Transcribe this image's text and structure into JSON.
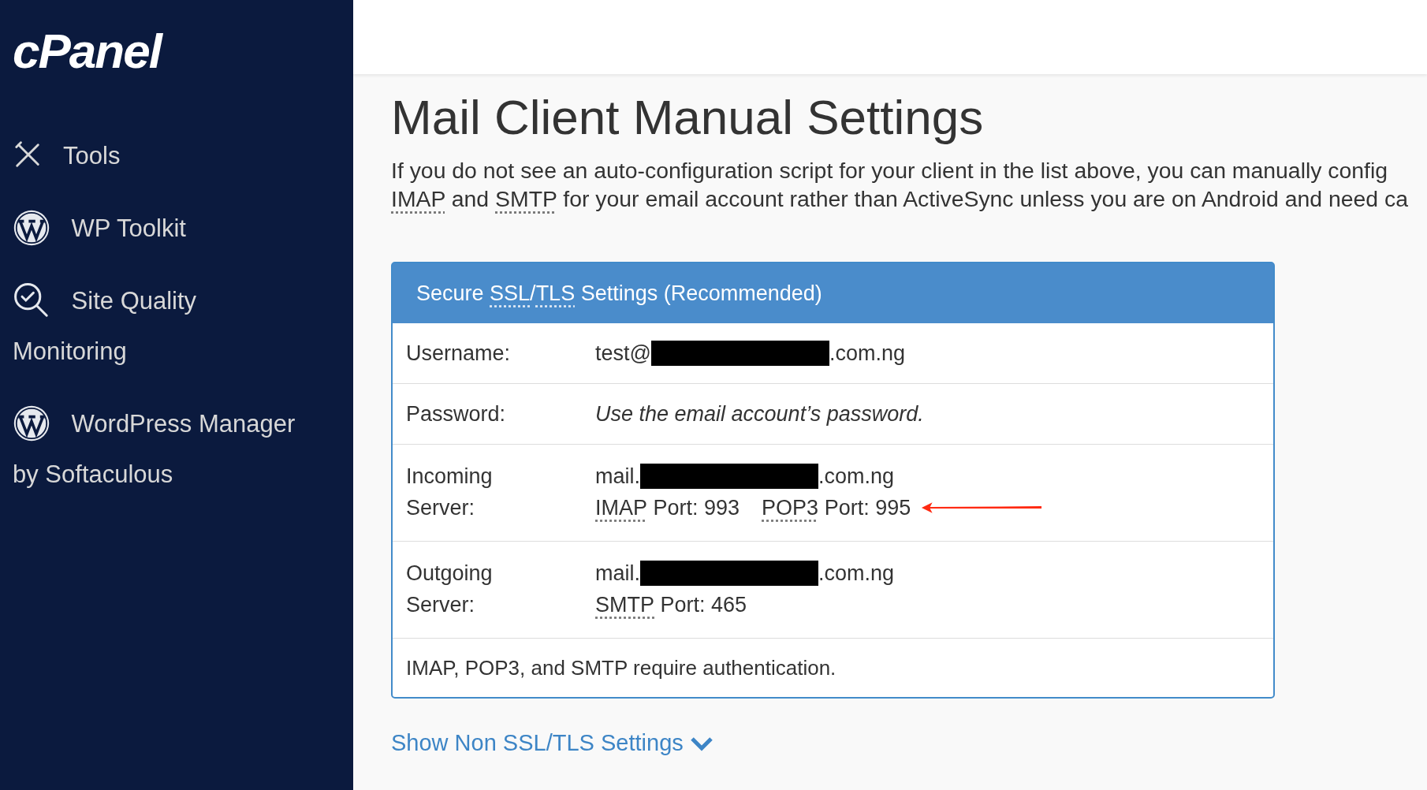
{
  "sidebar": {
    "logo": "cPanel",
    "items": [
      {
        "kind": "tools",
        "label": "Tools"
      },
      {
        "kind": "wordpress",
        "label": "WP Toolkit"
      },
      {
        "kind": "search",
        "label": "Site Quality Monitoring"
      },
      {
        "kind": "wordpress",
        "label": "WordPress Manager by Softaculous"
      }
    ]
  },
  "page": {
    "title": "Mail Client Manual Settings",
    "intro_lines": [
      [
        {
          "kind": "text",
          "text": "If you do not see an auto-configuration script for your client in the list above, you can manually config"
        }
      ],
      [
        {
          "kind": "abbr",
          "text": "IMAP"
        },
        {
          "kind": "text",
          "text": " and "
        },
        {
          "kind": "abbr",
          "text": "SMTP"
        },
        {
          "kind": "text",
          "text": " for your email account rather than ActiveSync unless you are on Android and need ca"
        }
      ]
    ]
  },
  "settings_panel": {
    "title": [
      {
        "kind": "text",
        "text": "Secure "
      },
      {
        "kind": "abbr",
        "text": "SSL"
      },
      {
        "kind": "text",
        "text": "/"
      },
      {
        "kind": "abbr",
        "text": "TLS"
      },
      {
        "kind": "text",
        "text": " Settings (Recommended)"
      }
    ],
    "rows": [
      {
        "label": "Username:",
        "lines": [
          [
            {
              "kind": "text",
              "text": "test@"
            },
            {
              "kind": "redacted"
            },
            {
              "kind": "text",
              "text": ".com.ng"
            }
          ]
        ]
      },
      {
        "label": "Password:",
        "lines": [
          [
            {
              "kind": "italic",
              "text": "Use the email account’s password."
            }
          ]
        ]
      },
      {
        "label": "Incoming Server:",
        "lines": [
          [
            {
              "kind": "text",
              "text": "mail."
            },
            {
              "kind": "redacted"
            },
            {
              "kind": "text",
              "text": ".com.ng"
            }
          ],
          [
            {
              "kind": "abbr",
              "text": "IMAP"
            },
            {
              "kind": "text",
              "text": " Port: 993"
            },
            {
              "kind": "gap"
            },
            {
              "kind": "abbr",
              "text": "POP3"
            },
            {
              "kind": "text",
              "text": " Port: 995"
            },
            {
              "kind": "arrow"
            }
          ]
        ]
      },
      {
        "label": "Outgoing Server:",
        "lines": [
          [
            {
              "kind": "text",
              "text": "mail."
            },
            {
              "kind": "redacted"
            },
            {
              "kind": "text",
              "text": ".com.ng"
            }
          ],
          [
            {
              "kind": "abbr",
              "text": "SMTP"
            },
            {
              "kind": "text",
              "text": " Port: 465"
            }
          ]
        ]
      }
    ],
    "footer": "IMAP, POP3, and SMTP require authentication."
  },
  "toggle_link": {
    "label": "Show Non SSL/TLS Settings",
    "expanded": false
  }
}
